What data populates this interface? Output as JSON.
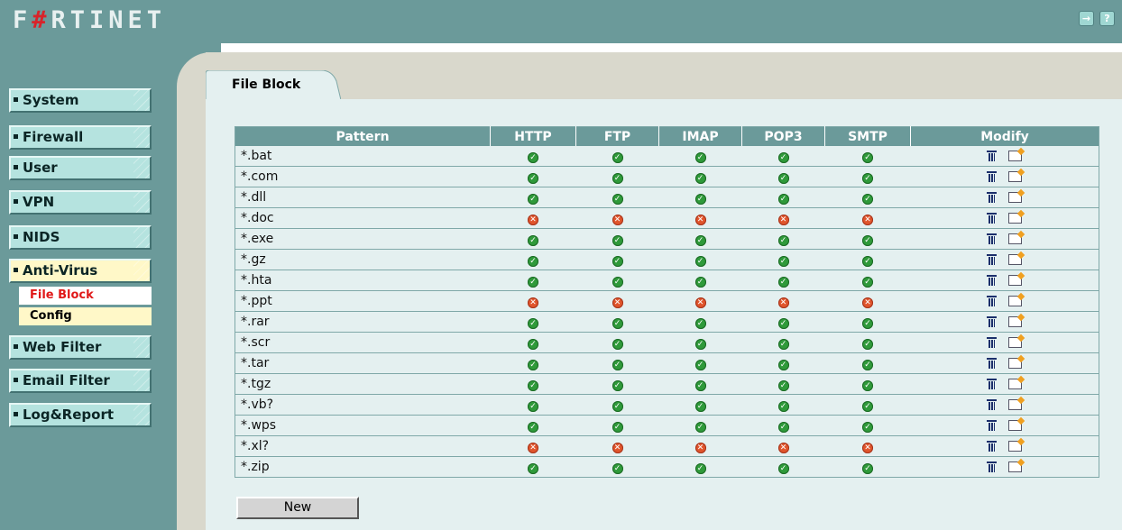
{
  "brand": {
    "logo_prefix": "F",
    "logo_mark": "#",
    "logo_suffix": "RTINET"
  },
  "nav": [
    {
      "label": "System",
      "name": "nav-system",
      "active": false
    },
    {
      "label": "Firewall",
      "name": "nav-firewall",
      "active": false
    },
    {
      "label": "User",
      "name": "nav-user",
      "active": false
    },
    {
      "label": "VPN",
      "name": "nav-vpn",
      "active": false
    },
    {
      "label": "NIDS",
      "name": "nav-nids",
      "active": false
    },
    {
      "label": "Anti-Virus",
      "name": "nav-anti-virus",
      "active": true
    },
    {
      "label": "Web Filter",
      "name": "nav-web-filter",
      "active": false
    },
    {
      "label": "Email Filter",
      "name": "nav-email-filter",
      "active": false
    },
    {
      "label": "Log&Report",
      "name": "nav-log-report",
      "active": false
    }
  ],
  "subnav": {
    "file_block": "File Block",
    "config": "Config"
  },
  "tab": {
    "title": "File Block"
  },
  "table": {
    "columns": [
      "Pattern",
      "HTTP",
      "FTP",
      "IMAP",
      "POP3",
      "SMTP",
      "Modify"
    ],
    "rows": [
      {
        "pattern": "*.bat",
        "states": [
          "ok",
          "ok",
          "ok",
          "ok",
          "ok"
        ]
      },
      {
        "pattern": "*.com",
        "states": [
          "ok",
          "ok",
          "ok",
          "ok",
          "ok"
        ]
      },
      {
        "pattern": "*.dll",
        "states": [
          "ok",
          "ok",
          "ok",
          "ok",
          "ok"
        ]
      },
      {
        "pattern": "*.doc",
        "states": [
          "no",
          "no",
          "no",
          "no",
          "no"
        ]
      },
      {
        "pattern": "*.exe",
        "states": [
          "ok",
          "ok",
          "ok",
          "ok",
          "ok"
        ]
      },
      {
        "pattern": "*.gz",
        "states": [
          "ok",
          "ok",
          "ok",
          "ok",
          "ok"
        ]
      },
      {
        "pattern": "*.hta",
        "states": [
          "ok",
          "ok",
          "ok",
          "ok",
          "ok"
        ]
      },
      {
        "pattern": "*.ppt",
        "states": [
          "no",
          "no",
          "no",
          "no",
          "no"
        ]
      },
      {
        "pattern": "*.rar",
        "states": [
          "ok",
          "ok",
          "ok",
          "ok",
          "ok"
        ]
      },
      {
        "pattern": "*.scr",
        "states": [
          "ok",
          "ok",
          "ok",
          "ok",
          "ok"
        ]
      },
      {
        "pattern": "*.tar",
        "states": [
          "ok",
          "ok",
          "ok",
          "ok",
          "ok"
        ]
      },
      {
        "pattern": "*.tgz",
        "states": [
          "ok",
          "ok",
          "ok",
          "ok",
          "ok"
        ]
      },
      {
        "pattern": "*.vb?",
        "states": [
          "ok",
          "ok",
          "ok",
          "ok",
          "ok"
        ]
      },
      {
        "pattern": "*.wps",
        "states": [
          "ok",
          "ok",
          "ok",
          "ok",
          "ok"
        ]
      },
      {
        "pattern": "*.xl?",
        "states": [
          "no",
          "no",
          "no",
          "no",
          "no"
        ]
      },
      {
        "pattern": "*.zip",
        "states": [
          "ok",
          "ok",
          "ok",
          "ok",
          "ok"
        ]
      }
    ]
  },
  "actions": {
    "new_label": "New"
  },
  "icons": {
    "enabled": "check-circle-icon",
    "disabled": "cross-circle-icon",
    "delete": "trash-icon",
    "edit": "edit-icon",
    "logout": "logout-icon",
    "help": "help-icon"
  },
  "colors": {
    "header": "#6b9a9a",
    "nav_button": "#b5e3df",
    "active_nav": "#fff8c8",
    "enabled": "#2f9a3a",
    "disabled": "#e0552c",
    "active_sub": "#e01818"
  }
}
